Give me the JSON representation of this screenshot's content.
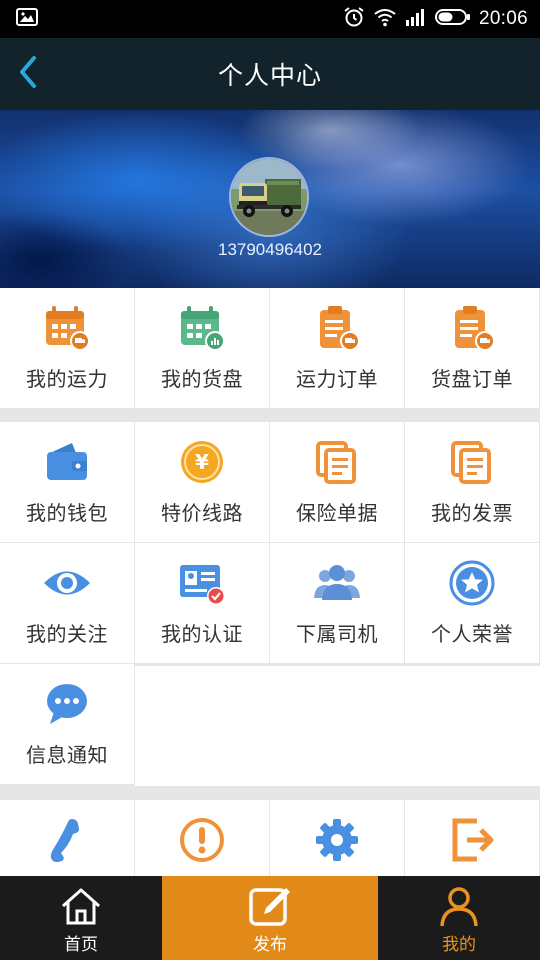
{
  "status_bar": {
    "time": "20:06"
  },
  "header": {
    "title": "个人中心"
  },
  "profile": {
    "phone": "13790496402"
  },
  "grid_top": [
    {
      "label": "我的运力",
      "icon": "calendar-truck-icon",
      "color": "#f0923a"
    },
    {
      "label": "我的货盘",
      "icon": "calendar-chart-icon",
      "color": "#5bb88a"
    },
    {
      "label": "运力订单",
      "icon": "clipboard-truck-icon",
      "color": "#f0923a"
    },
    {
      "label": "货盘订单",
      "icon": "clipboard-truck-icon",
      "color": "#f0923a"
    }
  ],
  "grid_services": [
    {
      "label": "我的钱包",
      "icon": "wallet-icon",
      "color": "#4a90e2"
    },
    {
      "label": "特价线路",
      "icon": "yuan-coin-icon",
      "color": "#f5a623"
    },
    {
      "label": "保险单据",
      "icon": "documents-icon",
      "color": "#f0923a"
    },
    {
      "label": "我的发票",
      "icon": "documents-icon",
      "color": "#f0923a"
    },
    {
      "label": "我的关注",
      "icon": "eye-icon",
      "color": "#4a90e2"
    },
    {
      "label": "我的认证",
      "icon": "id-card-icon",
      "color": "#4a90e2"
    },
    {
      "label": "下属司机",
      "icon": "group-icon",
      "color": "#5b8fd6"
    },
    {
      "label": "个人荣誉",
      "icon": "star-badge-icon",
      "color": "#4a90e2"
    },
    {
      "label": "信息通知",
      "icon": "chat-bubble-icon",
      "color": "#4a90e2"
    }
  ],
  "grid_bottom": [
    {
      "label": "",
      "icon": "phone-icon",
      "color": "#4a90e2"
    },
    {
      "label": "",
      "icon": "alert-icon",
      "color": "#f0923a"
    },
    {
      "label": "",
      "icon": "gear-icon",
      "color": "#4a90e2"
    },
    {
      "label": "",
      "icon": "logout-icon",
      "color": "#f0923a"
    }
  ],
  "nav": {
    "home": "首页",
    "publish": "发布",
    "mine": "我的"
  },
  "colors": {
    "header_bg": "#13232b",
    "accent_orange": "#e28a19",
    "nav_bg": "#1b1b1b"
  }
}
